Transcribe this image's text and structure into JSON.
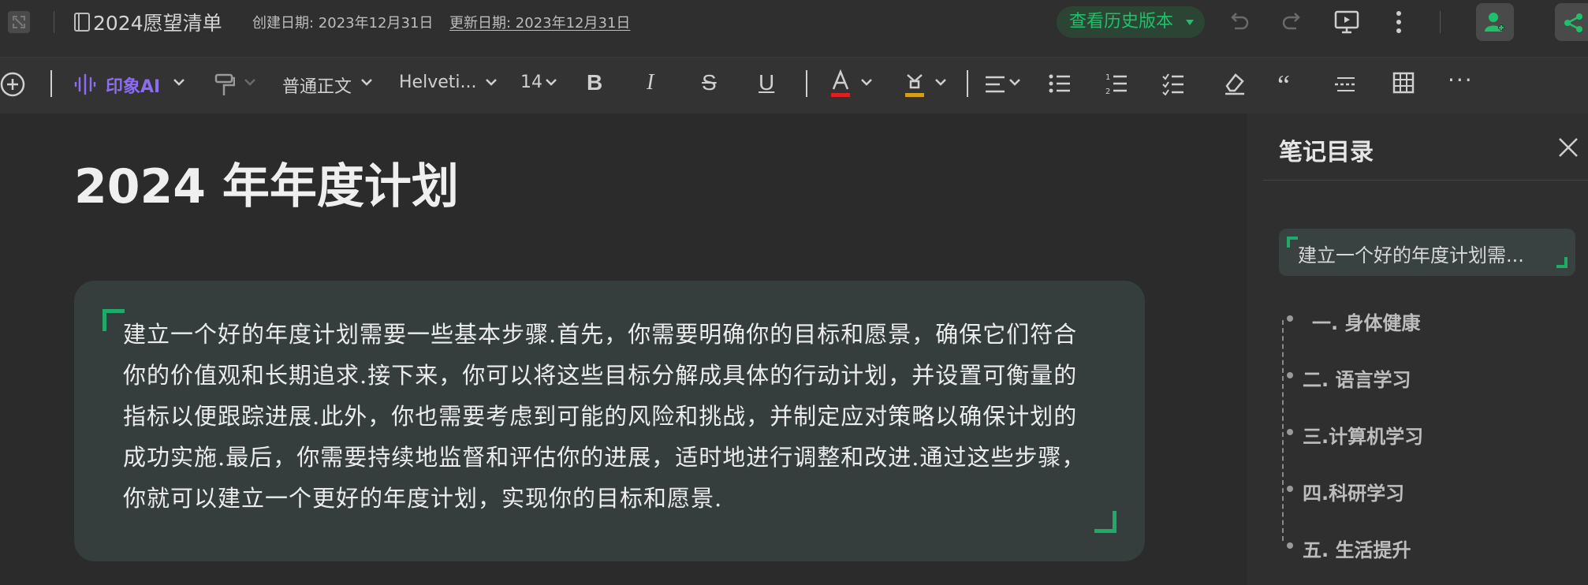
{
  "topbar": {
    "note_title": "2024愿望清单",
    "created": "创建日期: 2023年12月31日",
    "updated": "更新日期: 2023年12月31日",
    "history_button": "查看历史版本"
  },
  "toolbar": {
    "ai_label": "印象AI",
    "paragraph_style": "普通正文",
    "font_family": "Helveti...",
    "font_size": "14",
    "bold": "B",
    "italic": "I",
    "strike": "S",
    "underline": "U",
    "quote": "“",
    "more": "···"
  },
  "document": {
    "title": "2024 年年度计划",
    "callout_text": "建立一个好的年度计划需要一些基本步骤.首先，你需要明确你的目标和愿景，确保它们符合你的价值观和长期追求.接下来，你可以将这些目标分解成具体的行动计划，并设置可衡量的指标以便跟踪进展.此外，你也需要考虑到可能的风险和挑战，并制定应对策略以确保计划的成功实施.最后，你需要持续地监督和评估你的进展，适时地进行调整和改进.通过这些步骤，你就可以建立一个更好的年度计划，实现你的目标和愿景."
  },
  "outline": {
    "title": "笔记目录",
    "current": "建立一个好的年度计划需...",
    "items": [
      "一. 身体健康",
      "二. 语言学习",
      "三.计算机学习",
      "四.科研学习",
      "五. 生活提升"
    ]
  },
  "colors": {
    "accent_green": "#1fc06a",
    "ai_purple": "#8c6cf0",
    "callout_bg": "#363d3d",
    "font_color_bar": "#e02020",
    "highlight_bar": "#d4a017"
  }
}
